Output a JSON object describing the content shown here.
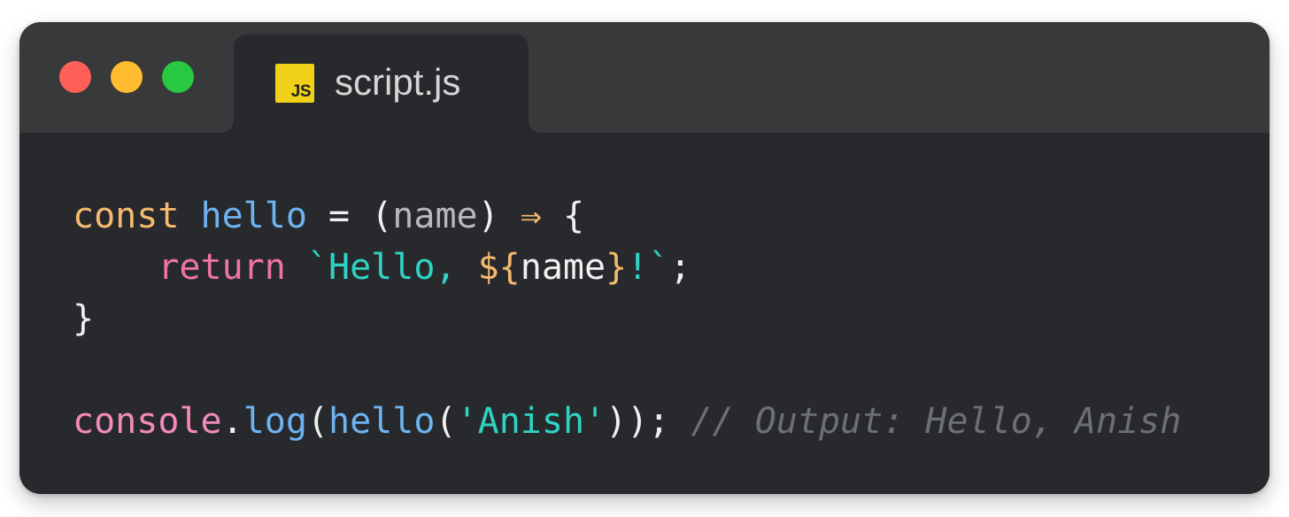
{
  "window": {
    "controls": {
      "close": "close",
      "minimize": "minimize",
      "zoom": "zoom"
    },
    "tab": {
      "icon_text": "JS",
      "label": "script.js"
    }
  },
  "code": {
    "line1": {
      "keyword": "const",
      "name": "hello",
      "equals": " = ",
      "open_paren": "(",
      "param": "name",
      "close_paren": ")",
      "arrow": "⇒",
      "brace": "{"
    },
    "line2": {
      "indent": "    ",
      "keyword": "return",
      "string_start": "`Hello, ",
      "interp_open": "${",
      "interp_var": "name",
      "interp_close": "}",
      "string_end": "!`",
      "semicolon": ";"
    },
    "line3": {
      "brace": "}"
    },
    "line5": {
      "object": "console",
      "dot": ".",
      "method": "log",
      "open_paren": "(",
      "call": "hello",
      "inner_open": "(",
      "argument": "'Anish'",
      "closing": "));",
      "comment": "// Output: Hello, Anish"
    }
  },
  "colors": {
    "window_background": "#28292c",
    "titlebar_background": "#37393a",
    "close_dot": "#fe5f57",
    "minimize_dot": "#febc2e",
    "zoom_dot": "#28c840",
    "js_badge": "#f0d019",
    "keyword": "#f6ba6f",
    "function": "#6db3f2",
    "return_keyword": "#ee73a8",
    "string": "#2ed3c4",
    "comment": "#6d6f78"
  }
}
